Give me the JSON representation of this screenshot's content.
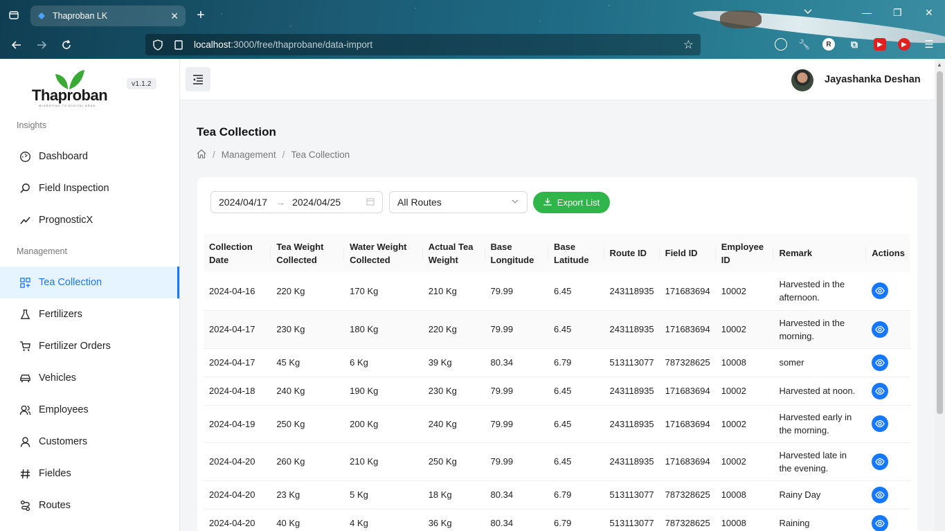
{
  "browser": {
    "tab_title": "Thaproban LK",
    "url_host": "localhost",
    "url_rest": ":3000/free/thaprobane/data-import"
  },
  "sidebar": {
    "logo_text": "Thaproban",
    "logo_tagline": "MIGRATING TO DIGITAL AREA",
    "version": "v1.1.2",
    "sections": [
      {
        "title": "Insights",
        "items": [
          {
            "label": "Dashboard",
            "icon": "dashboard-icon"
          },
          {
            "label": "Field Inspection",
            "icon": "search-icon"
          },
          {
            "label": "PrognosticX",
            "icon": "trend-icon"
          }
        ]
      },
      {
        "title": "Management",
        "items": [
          {
            "label": "Tea Collection",
            "icon": "grid-icon",
            "active": true
          },
          {
            "label": "Fertilizers",
            "icon": "flask-icon"
          },
          {
            "label": "Fertilizer Orders",
            "icon": "cart-icon"
          },
          {
            "label": "Vehicles",
            "icon": "car-icon"
          },
          {
            "label": "Employees",
            "icon": "users-icon"
          },
          {
            "label": "Customers",
            "icon": "user-icon"
          },
          {
            "label": "Fieldes",
            "icon": "hash-icon"
          },
          {
            "label": "Routes",
            "icon": "route-icon"
          }
        ]
      }
    ]
  },
  "header": {
    "username": "Jayashanka Deshan"
  },
  "page": {
    "title": "Tea Collection",
    "breadcrumb": [
      "Management",
      "Tea Collection"
    ]
  },
  "filters": {
    "date_start": "2024/04/17",
    "date_end": "2024/04/25",
    "route_select": "All Routes",
    "export_label": "Export List"
  },
  "table": {
    "columns": [
      "Collection Date",
      "Tea Weight Collected",
      "Water Weight Collected",
      "Actual Tea Weight",
      "Base Longitude",
      "Base Latitude",
      "Route ID",
      "Field ID",
      "Employee ID",
      "Remark",
      "Actions"
    ],
    "rows": [
      [
        "2024-04-16",
        "220 Kg",
        "170 Kg",
        "210 Kg",
        "79.99",
        "6.45",
        "243118935",
        "171683694",
        "10002",
        "Harvested in the afternoon."
      ],
      [
        "2024-04-17",
        "230 Kg",
        "180 Kg",
        "220 Kg",
        "79.99",
        "6.45",
        "243118935",
        "171683694",
        "10002",
        "Harvested in the morning."
      ],
      [
        "2024-04-17",
        "45 Kg",
        "6 Kg",
        "39 Kg",
        "80.34",
        "6.79",
        "513113077",
        "787328625",
        "10008",
        "somer"
      ],
      [
        "2024-04-18",
        "240 Kg",
        "190 Kg",
        "230 Kg",
        "79.99",
        "6.45",
        "243118935",
        "171683694",
        "10002",
        "Harvested at noon."
      ],
      [
        "2024-04-19",
        "250 Kg",
        "200 Kg",
        "240 Kg",
        "79.99",
        "6.45",
        "243118935",
        "171683694",
        "10002",
        "Harvested early in the morning."
      ],
      [
        "2024-04-20",
        "260 Kg",
        "210 Kg",
        "250 Kg",
        "79.99",
        "6.45",
        "243118935",
        "171683694",
        "10002",
        "Harvested late in the evening."
      ],
      [
        "2024-04-20",
        "23 Kg",
        "5 Kg",
        "18 Kg",
        "80.34",
        "6.79",
        "513113077",
        "787328625",
        "10008",
        "Rainy Day"
      ],
      [
        "2024-04-20",
        "40 Kg",
        "4 Kg",
        "36 Kg",
        "80.34",
        "6.79",
        "513113077",
        "787328625",
        "10008",
        "Raining"
      ]
    ]
  },
  "colors": {
    "accent": "#1677ff",
    "export_green": "#2fb54a",
    "logo_green": "#3aa935"
  }
}
